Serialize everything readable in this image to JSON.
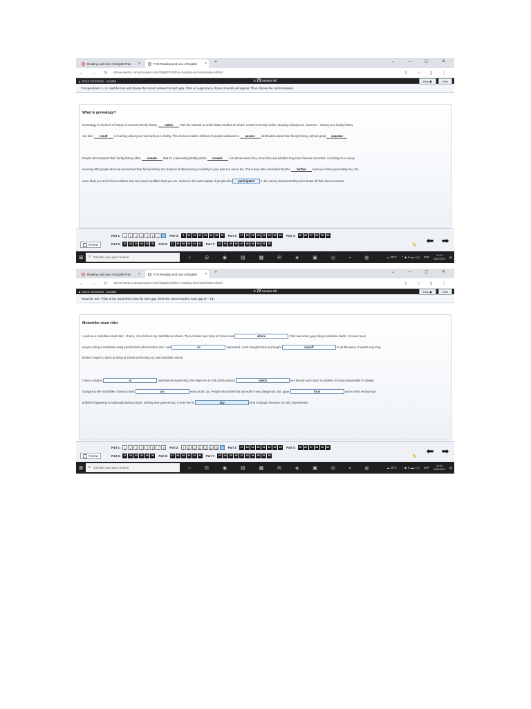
{
  "shots": [
    {
      "browser": {
        "tab1": "Reading and Use of English Prac",
        "tab2": "FCE Reading and Use of English",
        "url": "s3-eu-west-1.amazonaws.com/cbpt/2015/fce-reading-and-use/index.shtml"
      },
      "exam": {
        "user": "XXXX XXXXXXX - 123456",
        "timer_num": "73",
        "timer_text": "minutes left",
        "help": "Help",
        "hide": "Hide",
        "instruction": "For questions 1 – 8, read the text and choose the correct answer for each gap. Click on a gap and a choice of words will appear. Then choose the correct answer.",
        "title": "What is genealogy?",
        "p1": {
          "a": "Genealogy is a branch of history.  It concerns family history,",
          "g1": "rather",
          "b": "than the national or world history studied at school.  It doesn't merely involve drawing a family tree, however – tracing your family history",
          "c": "can also",
          "g2": "result",
          "d": "in learning about your roots and your identity.  The internet enables millions of people worldwide to",
          "g3": "access",
          "e": "information about their family history, without great",
          "g4": "expense"
        },
        "p2": {
          "a": "People who research their family history often",
          "g5": "remark",
          "b": "that it's a fascinating hobby which",
          "g6": "reveals",
          "c": "a lot about where they come from and whether they have famous ancestors.  According to a survey",
          "d": "involving 900 people who had researched their family history, the chances of discovering a celebrity in your past are one in ten.  The survey also concluded that the",
          "g7": "further",
          "e": "back you follow your family tree, the",
          "f": "more likely you are to find a relation who was much wealthier than you are.  However, the vast majority of people who",
          "g8": "participated",
          "g": "in the survey discovered they were better off than their ancestors."
        }
      },
      "taskbar": {
        "search": "Escribe aquí para buscar",
        "weather": "28°C",
        "lang": "ESP",
        "time": "14:41",
        "date": "16/8/2022"
      }
    },
    {
      "browser": {
        "tab1": "Reading and Use of English Prac",
        "tab2": "FCE Reading and Use of English",
        "url": "s3-eu-west-1.amazonaws.com/cbpt/2015/fce-reading-and-use/index.shtml"
      },
      "exam": {
        "user": "XXXX XXXXXXX - 123456",
        "timer_num": "72",
        "timer_text": "minutes left",
        "help": "Help",
        "hide": "Hide",
        "instruction": "Read the text. Think of the word which best fits each gap. Write the correct word in each gap (9 – 16).",
        "title": "Motorbike stunt rider",
        "p1": {
          "a": "I work as a motorbike stunt rider – that is, I do tricks on my motorbike at shows. The Le Mans race track in France was",
          "g9": "where",
          "b": "I first saw some guys doing motorbike stunts. I'd never seen",
          "c": "anyone riding a motorbike using just the back wheel before and I was",
          "g10": "so",
          "d": "impressed I went straight home and taught",
          "g11": "myself",
          "e": "to do the same. It wasn't very long",
          "f": "before I began to earn my living at shows performing my own motorbike stunts."
        },
        "p2": {
          "a": "I have a degree",
          "g12": "in",
          "b": "mechanical engineering; this helps me to look at the physics",
          "g13": "which",
          "c": "lies behind each stunt. In addition to being responsible for design",
          "d": "changes to the motorbike, I have to work",
          "g14": "out",
          "e": "every stunt I do. People often think that my work is very dangerous, but, apart",
          "g15": "from",
          "f": "some minor mechanical",
          "g": "problem happening occasionally during a stunt, nothing ever goes wrong. I never feel in",
          "g16": "any",
          "h": "kind of danger because I'm very experienced."
        }
      },
      "taskbar": {
        "search": "Escribe aquí para buscar",
        "weather": "28°C",
        "lang": "ESP",
        "time": "14:42",
        "date": "16/8/2022"
      }
    }
  ],
  "nav": {
    "review": "Review",
    "parts": [
      "Part 1:",
      "Part 2:",
      "Part 3:",
      "Part 4:",
      "Part 5:",
      "Part 6:",
      "Part 7:"
    ],
    "part1": [
      "1",
      "2",
      "3",
      "4",
      "5",
      "6",
      "7",
      "8"
    ],
    "part2": [
      "9",
      "10",
      "11",
      "12",
      "13",
      "14",
      "15",
      "16"
    ],
    "part3": [
      "17",
      "18",
      "19",
      "20",
      "21",
      "22",
      "23",
      "24"
    ],
    "part4": [
      "25",
      "26",
      "27",
      "28",
      "29",
      "30"
    ],
    "part5": [
      "31",
      "32",
      "33",
      "34",
      "35",
      "36"
    ],
    "part6": [
      "37",
      "38",
      "39",
      "40",
      "41",
      "42"
    ],
    "part7": [
      "43",
      "44",
      "45",
      "46",
      "47",
      "48",
      "49",
      "50",
      "51",
      "52"
    ]
  }
}
